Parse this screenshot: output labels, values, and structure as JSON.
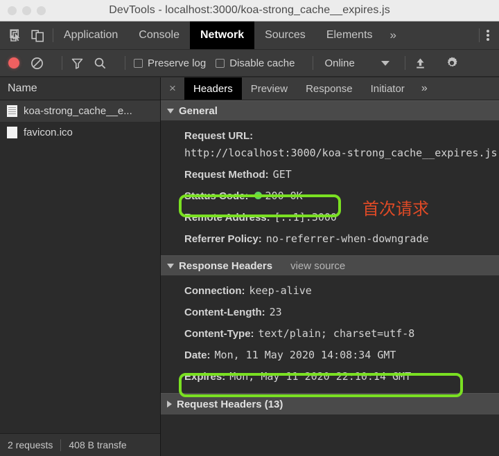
{
  "window": {
    "title": "DevTools - localhost:3000/koa-strong_cache__expires.js",
    "traffic_lights": [
      "close-button",
      "minimize-button",
      "maximize-button"
    ]
  },
  "devtools_tabbar": {
    "left_icons": [
      {
        "name": "inspect-element-icon",
        "label": "Inspect"
      },
      {
        "name": "device-toolbar-icon",
        "label": "Toggle device toolbar"
      }
    ],
    "tabs": [
      {
        "label": "Application",
        "active": false
      },
      {
        "label": "Console",
        "active": false
      },
      {
        "label": "Network",
        "active": true
      },
      {
        "label": "Sources",
        "active": false
      },
      {
        "label": "Elements",
        "active": false
      }
    ],
    "overflow_label": "»",
    "kebab_label": "More tools"
  },
  "network_toolbar": {
    "record_label": "Stop recording network log",
    "clear_label": "Clear",
    "filter_label": "Filter",
    "search_label": "Search",
    "preserve_log": {
      "label": "Preserve log",
      "checked": false
    },
    "disable_cache": {
      "label": "Disable cache",
      "checked": false
    },
    "throttle": {
      "value": "Online",
      "caret": "▼"
    },
    "import_label": "Import HAR",
    "settings_label": "Network settings"
  },
  "requests_panel": {
    "column_header": "Name",
    "rows": [
      {
        "name": "koa-strong_cache__e...",
        "selected": true,
        "icon": "script-file-icon"
      },
      {
        "name": "favicon.ico",
        "selected": false,
        "icon": "image-file-icon"
      }
    ],
    "status_bar": {
      "requests": "2 requests",
      "transferred": "408 B transfe"
    }
  },
  "details_panel": {
    "close_label": "×",
    "tabs": [
      {
        "label": "Headers",
        "active": true
      },
      {
        "label": "Preview",
        "active": false
      },
      {
        "label": "Response",
        "active": false
      },
      {
        "label": "Initiator",
        "active": false
      }
    ],
    "overflow_label": "»",
    "general": {
      "title": "General",
      "expanded": true,
      "rows": [
        {
          "key": "Request URL:",
          "value": "http://localhost:3000/koa-strong_cache__expires.js"
        },
        {
          "key": "Request Method:",
          "value": "GET"
        },
        {
          "key": "Status Code:",
          "value": "200 OK",
          "status_dot": "#5fd45f",
          "highlighted": true
        },
        {
          "key": "Remote Address:",
          "value": "[::1]:3000"
        },
        {
          "key": "Referrer Policy:",
          "value": "no-referrer-when-downgrade"
        }
      ]
    },
    "response_headers": {
      "title": "Response Headers",
      "view_source": "view source",
      "expanded": true,
      "rows": [
        {
          "key": "Connection:",
          "value": "keep-alive"
        },
        {
          "key": "Content-Length:",
          "value": "23"
        },
        {
          "key": "Content-Type:",
          "value": "text/plain; charset=utf-8"
        },
        {
          "key": "Date:",
          "value": "Mon, 11 May 2020 14:08:34 GMT"
        },
        {
          "key": "Expires:",
          "value": "Mon, May 11 2020 22:10:14 GMT",
          "highlighted": true
        }
      ]
    },
    "request_headers": {
      "title": "Request Headers (13)",
      "expanded": false
    }
  },
  "annotations": {
    "first_request_note": "首次请求",
    "highlight_color": "#7ae022",
    "note_color": "#df4a26"
  }
}
